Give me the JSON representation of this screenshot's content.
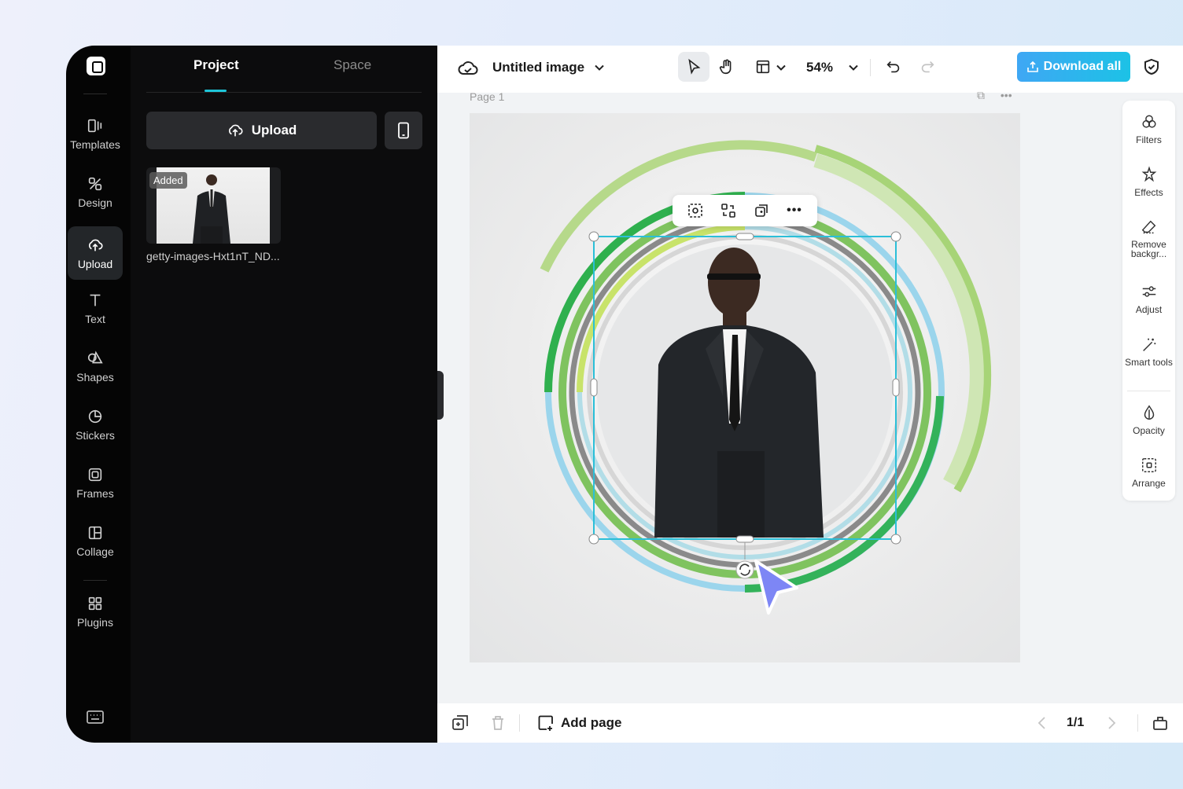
{
  "rail": {
    "items": [
      {
        "label": "Templates",
        "icon": "templates-icon"
      },
      {
        "label": "Design",
        "icon": "design-icon"
      },
      {
        "label": "Upload",
        "icon": "upload-cloud-icon",
        "active": true
      },
      {
        "label": "Text",
        "icon": "text-icon"
      },
      {
        "label": "Shapes",
        "icon": "shapes-icon"
      },
      {
        "label": "Stickers",
        "icon": "stickers-icon"
      },
      {
        "label": "Frames",
        "icon": "frames-icon"
      },
      {
        "label": "Collage",
        "icon": "collage-icon"
      },
      {
        "label": "Plugins",
        "icon": "plugins-icon"
      }
    ]
  },
  "panel": {
    "tabs": [
      "Project",
      "Space"
    ],
    "upload_label": "Upload",
    "asset": {
      "badge": "Added",
      "name": "getty-images-Hxt1nT_ND..."
    }
  },
  "topbar": {
    "title": "Untitled image",
    "zoom": "54%",
    "download_label": "Download all"
  },
  "canvas": {
    "page_label": "Page 1"
  },
  "right_tools": [
    {
      "label": "Filters"
    },
    {
      "label": "Effects"
    },
    {
      "label": "Remove backgr..."
    },
    {
      "label": "Adjust"
    },
    {
      "label": "Smart tools"
    },
    {
      "label": "Opacity"
    },
    {
      "label": "Arrange"
    }
  ],
  "bottombar": {
    "add_page_label": "Add page",
    "page_count": "1/1"
  },
  "colors": {
    "accent": "#1ec5d8",
    "download_start": "#3fa7f4",
    "download_end": "#1cc2e6",
    "selection": "#2bbfd8",
    "cursor": "#7d86f5"
  }
}
